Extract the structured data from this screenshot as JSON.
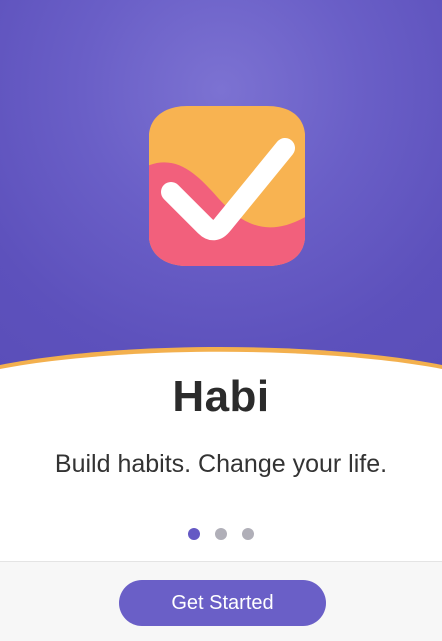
{
  "app": {
    "title": "Habi",
    "tagline": "Build habits. Change your life."
  },
  "icon": {
    "name": "checkmark-app-icon"
  },
  "pagination": {
    "count": 3,
    "active": 1
  },
  "cta": {
    "label": "Get Started"
  },
  "colors": {
    "hero_bg": "#5d51bc",
    "accent": "#6a5fc7",
    "icon_orange": "#f8b351",
    "icon_pink": "#f2607c",
    "curve_orange": "#f3b04e",
    "dot_inactive": "#b0afb8"
  }
}
